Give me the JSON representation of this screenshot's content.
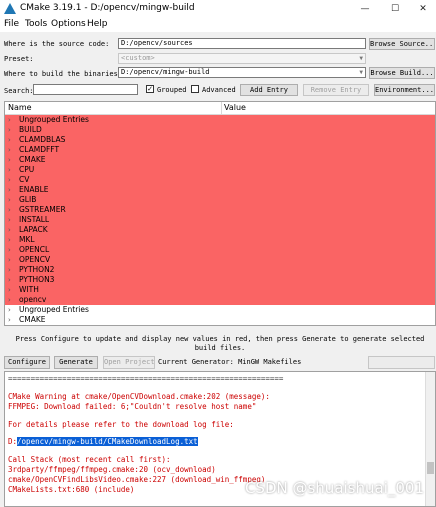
{
  "window": {
    "title": "CMake 3.19.1 - D:/opencv/mingw-build",
    "minimize": "—",
    "maximize": "☐",
    "close": "✕"
  },
  "menu": [
    "File",
    "Tools",
    "Options",
    "Help"
  ],
  "source": {
    "label": "Where is the source code:",
    "value": "D:/opencv/sources",
    "browse": "Browse Source..."
  },
  "preset": {
    "label": "Preset:",
    "value": "<custom>"
  },
  "build": {
    "label": "Where to build the binaries:",
    "value": "D:/opencv/mingw-build",
    "browse": "Browse Build..."
  },
  "toolbar": {
    "search_label": "Search:",
    "grouped_label": "Grouped",
    "grouped_checked": "✓",
    "advanced_label": "Advanced",
    "add_entry": "Add Entry",
    "remove_entry": "Remove Entry",
    "environment": "Environment..."
  },
  "tree": {
    "col_name": "Name",
    "col_value": "Value",
    "red_items": [
      "Ungrouped Entries",
      "BUILD",
      "CLAMDBLAS",
      "CLAMDFFT",
      "CMAKE",
      "CPU",
      "CV",
      "ENABLE",
      "GLIB",
      "GSTREAMER",
      "INSTALL",
      "LAPACK",
      "MKL",
      "OPENCL",
      "OPENCV",
      "PYTHON2",
      "PYTHON3",
      "WITH",
      "opencv"
    ],
    "normal_items": [
      "Ungrouped Entries",
      "CMAKE"
    ]
  },
  "info": "Press Configure to update and display new values in red, then press Generate to generate selected build files.",
  "actions": {
    "configure": "Configure",
    "generate": "Generate",
    "open_project": "Open Project",
    "generator": "Current Generator: MinGW Makefiles"
  },
  "output": {
    "rule": "=============================================================",
    "warn1": "CMake Warning at cmake/OpenCVDownload.cmake:202 (message):",
    "warn2": "  FFMPEG: Download failed: 6;\"Couldn't resolve host name\"",
    "warn3": "    For details please refer to the download log file:",
    "path_prefix": "    D:",
    "path_selected": "/opencv/mingw-build/CMakeDownloadLog.txt",
    "stack": "Call Stack (most recent call first):",
    "stack1": "  3rdparty/ffmpeg/ffmpeg.cmake:20 (ocv_download)",
    "stack2": "  cmake/OpenCVFindLibsVideo.cmake:227 (download_win_ffmpeg)",
    "stack3": "  CMakeLists.txt:680 (include)"
  },
  "watermark": "CSDN @shuaishuai_001",
  "colors": {
    "red_row": "#fa6464",
    "output_text": "#cc0000",
    "selection": "#0a5fd6"
  }
}
